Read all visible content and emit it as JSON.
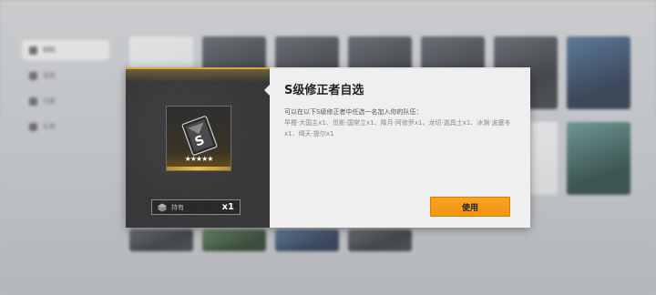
{
  "background": {
    "sidebar": {
      "items": [
        {
          "label": "材料",
          "active": true
        },
        {
          "label": "道具",
          "active": false
        },
        {
          "label": "功能",
          "active": false
        },
        {
          "label": "礼物",
          "active": false
        }
      ]
    }
  },
  "dialog": {
    "title": "S级修正者自选",
    "description": "可以在以下S级修正者中任选一名加入你的队伍：",
    "candidates": "早樱·大国主x1、觅影·国常立x1、降月·阿修罗x1、龙切·迦具土x1、冰渊·波塞冬x1、缉天·提尔x1",
    "item": {
      "rarity_stars": "★★★★★",
      "icon": "card-pack-icon"
    },
    "owned": {
      "label": "持有",
      "count": "x1"
    },
    "use_button_label": "使用"
  },
  "colors": {
    "accent_gold": "#d9a93a",
    "button_orange": "#f29416",
    "panel_dark": "#38383a",
    "panel_light": "#efefef"
  }
}
